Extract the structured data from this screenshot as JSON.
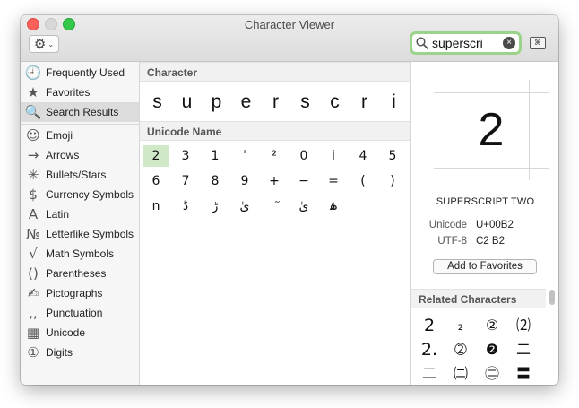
{
  "window": {
    "title": "Character Viewer"
  },
  "toolbar": {
    "gear_icon": "⚙",
    "gear_chevron": "⌄"
  },
  "search": {
    "value": "superscri",
    "clear_icon": "×",
    "keyboard_icon": "⌘"
  },
  "sidebar": {
    "items": [
      {
        "label": "Frequently Used",
        "icon": "🕘",
        "icon_name": "clock-icon"
      },
      {
        "label": "Favorites",
        "icon": "★",
        "icon_name": "star-icon"
      },
      {
        "label": "Search Results",
        "icon": "🔍",
        "icon_name": "search-icon",
        "selected": true
      },
      {
        "label": "Emoji",
        "icon": "☺",
        "icon_name": "smiley-icon"
      },
      {
        "label": "Arrows",
        "icon": "→",
        "icon_name": "arrow-icon"
      },
      {
        "label": "Bullets/Stars",
        "icon": "✳",
        "icon_name": "bullet-star-icon"
      },
      {
        "label": "Currency Symbols",
        "icon": "$",
        "icon_name": "dollar-icon"
      },
      {
        "label": "Latin",
        "icon": "A",
        "icon_name": "latin-a-icon"
      },
      {
        "label": "Letterlike Symbols",
        "icon": "№",
        "icon_name": "numero-icon"
      },
      {
        "label": "Math Symbols",
        "icon": "√",
        "icon_name": "square-root-icon"
      },
      {
        "label": "Parentheses",
        "icon": "()",
        "icon_name": "parentheses-icon"
      },
      {
        "label": "Pictographs",
        "icon": "✍",
        "icon_name": "pictograph-icon"
      },
      {
        "label": "Punctuation",
        "icon": ",,",
        "icon_name": "punctuation-icon"
      },
      {
        "label": "Unicode",
        "icon": "▦",
        "icon_name": "unicode-grid-icon"
      },
      {
        "label": "Digits",
        "icon": "①",
        "icon_name": "circled-digit-icon"
      }
    ]
  },
  "middle": {
    "character_header": "Character",
    "unicode_header": "Unicode Name",
    "characters": [
      "s",
      "u",
      "p",
      "e",
      "r",
      "s",
      "c",
      "r",
      "i"
    ],
    "unicode_rows": [
      [
        "2",
        "3",
        "1",
        "ˈ",
        "²",
        "0",
        "i",
        "4",
        "5"
      ],
      [
        "6",
        "7",
        "8",
        "9",
        "+",
        "−",
        "=",
        "(",
        ")"
      ],
      [
        "n",
        "ڈ",
        "ڑ",
        "ىٰ",
        "ٓ",
        "ىٰ",
        "ۿ"
      ]
    ],
    "selected_index": [
      0,
      0
    ]
  },
  "detail": {
    "glyph": "2",
    "name": "SUPERSCRIPT TWO",
    "unicode_label": "Unicode",
    "unicode_value": "U+00B2",
    "utf8_label": "UTF-8",
    "utf8_value": "C2 B2",
    "add_favorites_label": "Add to Favorites",
    "related_header": "Related Characters",
    "related_rows": [
      [
        "2",
        "₂",
        "②",
        "⑵"
      ],
      [
        "2.",
        "➁",
        "❷",
        "二"
      ],
      [
        "⼆",
        "㈡",
        "㊁",
        "〓"
      ]
    ]
  }
}
